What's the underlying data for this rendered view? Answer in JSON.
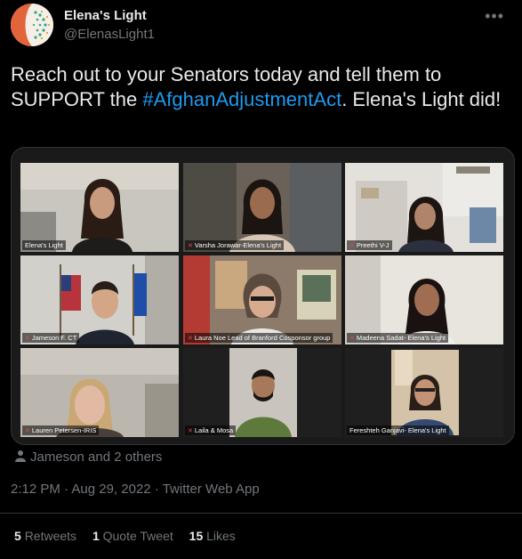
{
  "account": {
    "display_name": "Elena's Light",
    "handle": "@ElenasLight1"
  },
  "tweet": {
    "text_before": "Reach out to your Senators today and tell them to SUPPORT the ",
    "hashtag": "#AfghanAdjustmentAct",
    "text_after": ". Elena's Light did!"
  },
  "media": {
    "participants": [
      {
        "name": "Elena's Light"
      },
      {
        "name": "Varsha Jorawar-Elena's Light"
      },
      {
        "name": "Preethi V-J"
      },
      {
        "name": "Jameson F. CT"
      },
      {
        "name": "Laura Noe Lead of Branford Cosponsor group"
      },
      {
        "name": "Madeena Sadat- Elena's Light"
      },
      {
        "name": "Lauren Petersen-IRIS"
      },
      {
        "name": "Laila & Mosa"
      },
      {
        "name": "Fereshteh Ganjavi- Elena's Light"
      }
    ]
  },
  "tagged": "Jameson and 2 others",
  "meta": {
    "time": "2:12 PM",
    "date": "Aug 29, 2022",
    "source": "Twitter Web App"
  },
  "stats": {
    "retweets_count": "5",
    "retweets_label": "Retweets",
    "quotes_count": "1",
    "quotes_label": "Quote Tweet",
    "likes_count": "15",
    "likes_label": "Likes"
  }
}
